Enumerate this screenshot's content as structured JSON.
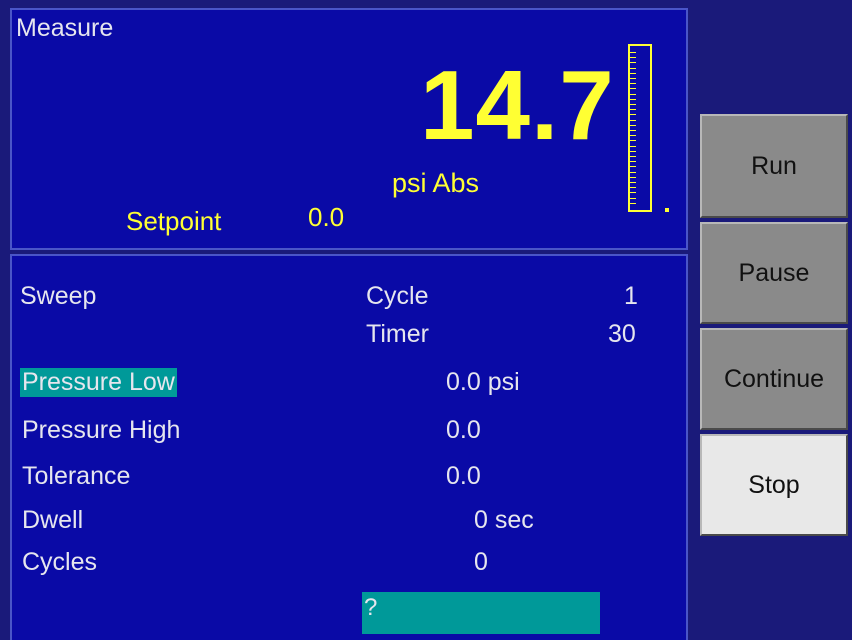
{
  "measure": {
    "title": "Measure",
    "value": "14.7",
    "unit": "psi Abs",
    "setpoint_label": "Setpoint",
    "setpoint_value": "0.0"
  },
  "sweep": {
    "title": "Sweep",
    "cycle_label": "Cycle",
    "cycle_value": "1",
    "timer_label": "Timer",
    "timer_value": "30"
  },
  "params": [
    {
      "label": "Pressure Low",
      "value": "0.0 psi",
      "highlighted": true
    },
    {
      "label": "Pressure High",
      "value": "0.0"
    },
    {
      "label": "Tolerance",
      "value": "0.0"
    },
    {
      "label": "Dwell",
      "value": "0 sec"
    },
    {
      "label": "Cycles",
      "value": "0"
    }
  ],
  "prompt": "?",
  "buttons": {
    "run": "Run",
    "pause": "Pause",
    "continue": "Continue",
    "stop": "Stop"
  },
  "colors": {
    "background": "#1a1a7a",
    "panel": "#0a0aa6",
    "accent_yellow": "#ffff33",
    "highlight": "#009999",
    "button_gray": "#8a8a8a",
    "button_light": "#e8e8e8"
  }
}
